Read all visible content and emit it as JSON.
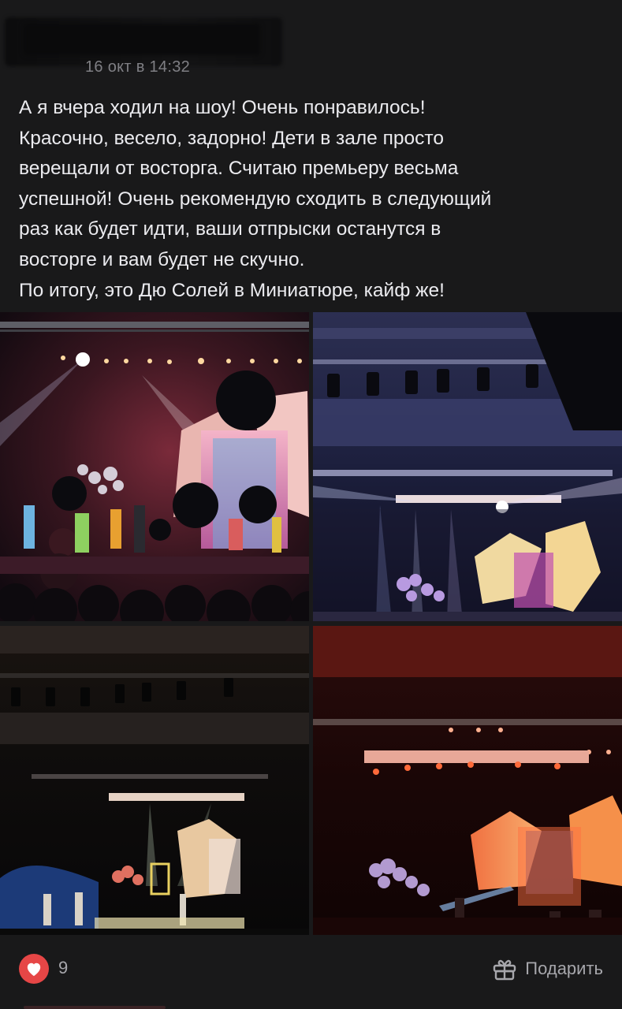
{
  "post": {
    "timestamp": "16 окт в 14:32",
    "text": "А я вчера ходил на шоу! Очень понравилось!\nКрасочно, весело, задорно! Дети в зале просто\nверещали от восторга. Считаю премьеру весьма\nуспешной! Очень рекомендую сходить в следующий\nраз как будет идти, ваши отпрыски останутся в\nвосторге и вам будет не скучно.\nПо итогу, это Дю Солей в Миниатюре, кайф же!"
  },
  "photos": [
    {
      "subject": "stage-show-photo-1"
    },
    {
      "subject": "stage-show-photo-2"
    },
    {
      "subject": "stage-show-photo-3"
    },
    {
      "subject": "stage-show-photo-4"
    }
  ],
  "footer": {
    "like_count": "9",
    "gift_label": "Подарить"
  },
  "colors": {
    "background": "#19191a",
    "like": "#e64646",
    "secondary_text": "#a7a7ac"
  },
  "icons": {
    "like": "heart-icon",
    "gift": "gift-icon"
  }
}
